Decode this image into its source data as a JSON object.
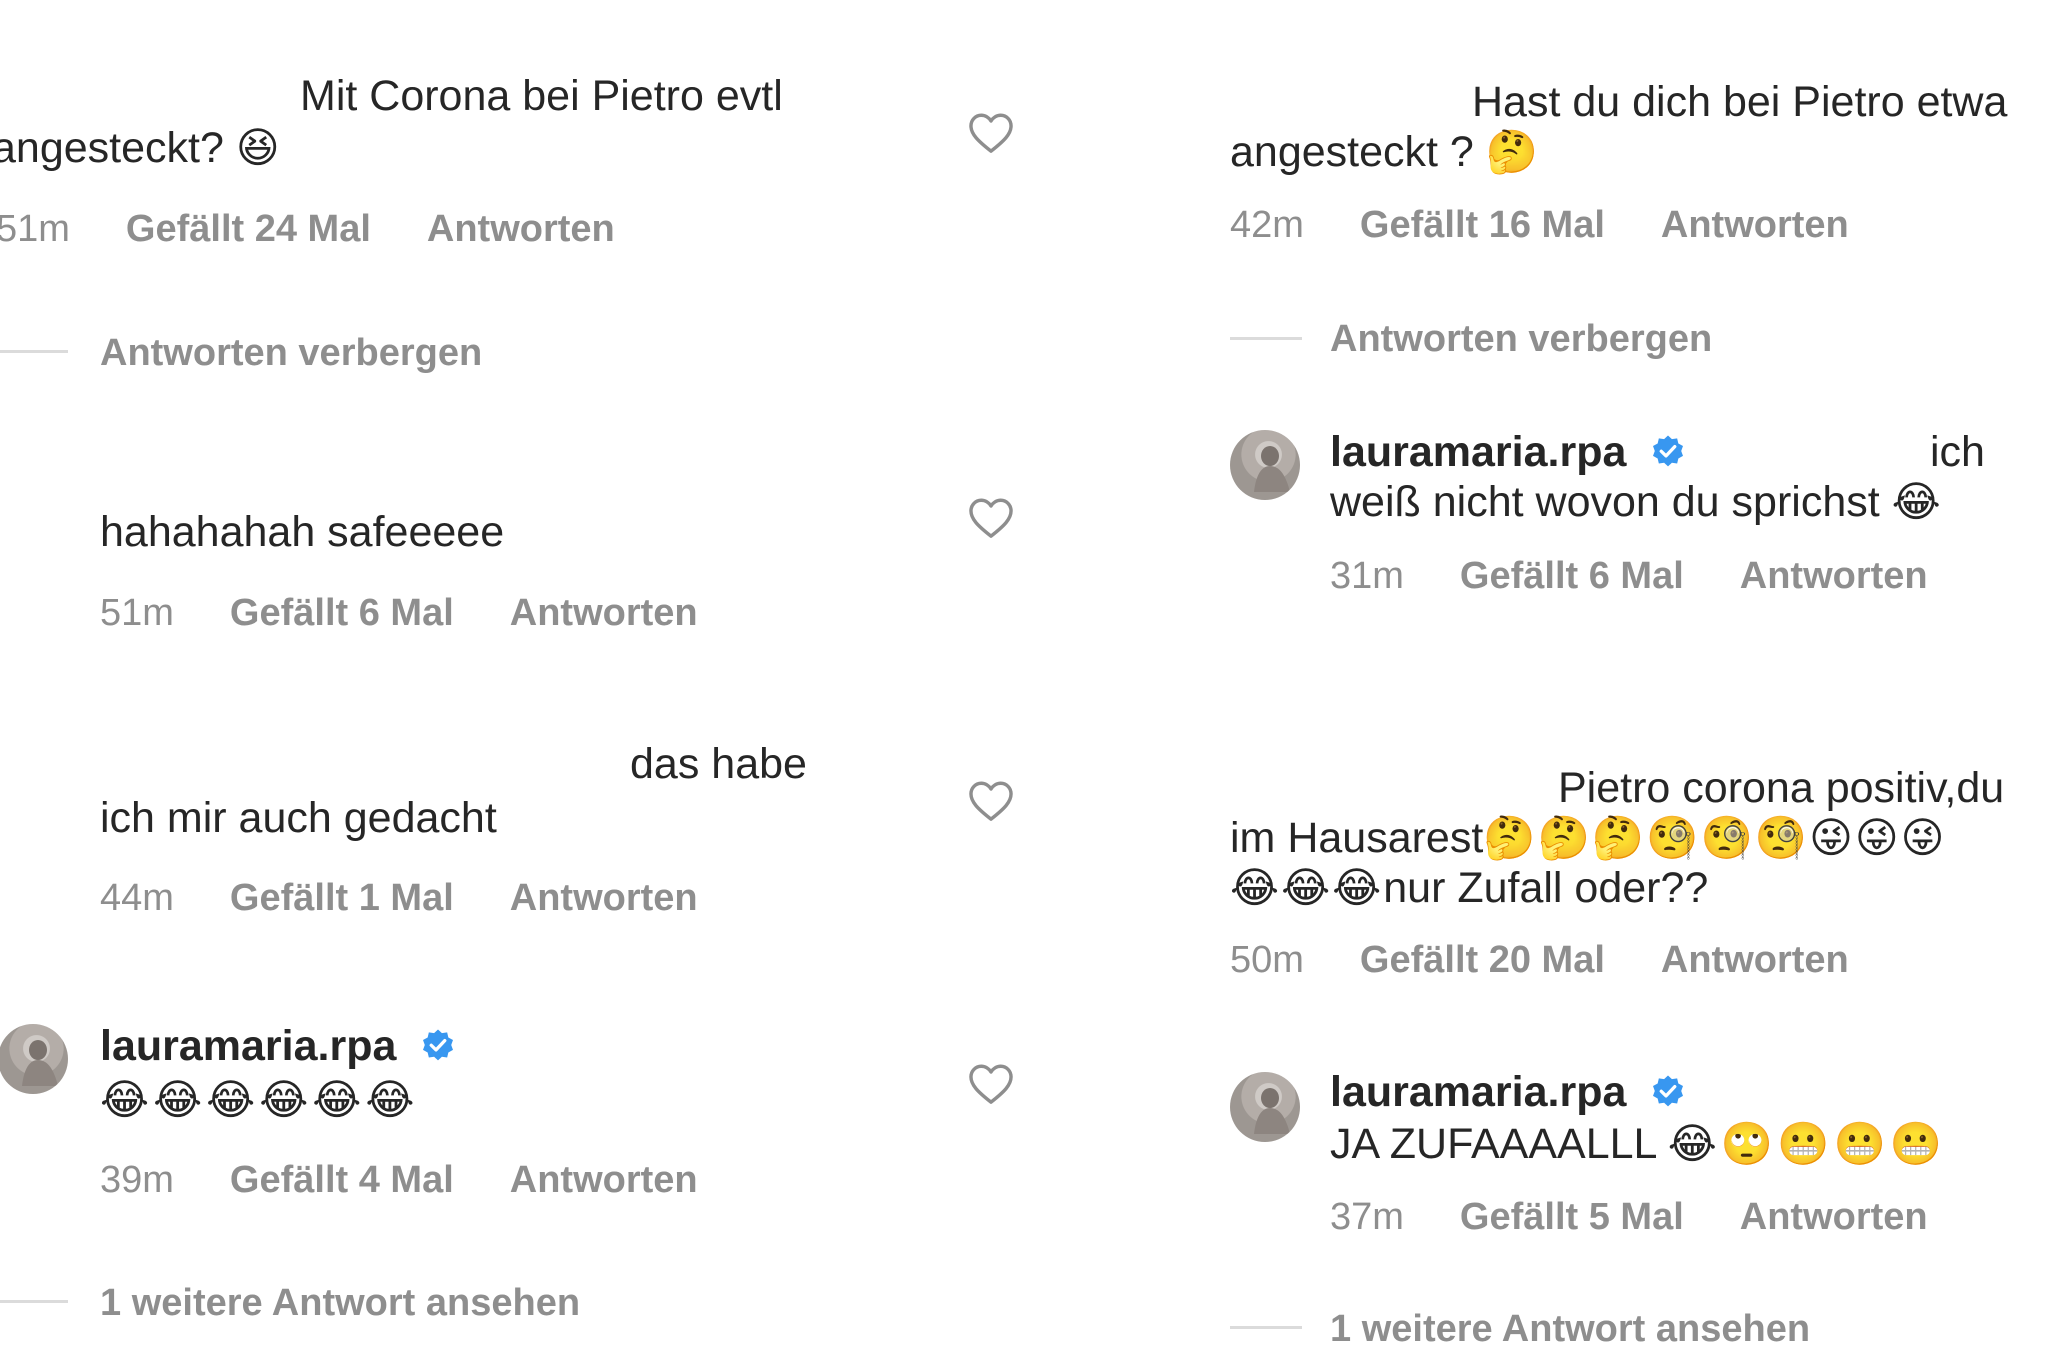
{
  "left": {
    "c1": {
      "line1": "Mit Corona bei Pietro evtl",
      "line2": "angesteckt?",
      "emoji": "😆",
      "time": "51m",
      "likes": "Gefällt 24 Mal",
      "reply": "Antworten"
    },
    "hide": "Antworten verbergen",
    "c2": {
      "text": "hahahahah safeeeee",
      "time": "51m",
      "likes": "Gefällt 6 Mal",
      "reply": "Antworten"
    },
    "c3": {
      "line1": "das habe",
      "line2": "ich mir auch gedacht",
      "time": "44m",
      "likes": "Gefällt 1 Mal",
      "reply": "Antworten"
    },
    "c4": {
      "user": "lauramaria.rpa",
      "emojis": "😂😂😂😂😂😂",
      "time": "39m",
      "likes": "Gefällt 4 Mal",
      "reply": "Antworten"
    },
    "more": "1 weitere Antwort ansehen"
  },
  "right": {
    "c1": {
      "line1": "Hast du dich bei Pietro etwa",
      "line2": "angesteckt ?",
      "emoji": "🤔",
      "time": "42m",
      "likes": "Gefällt 16 Mal",
      "reply": "Antworten"
    },
    "hide": "Antworten verbergen",
    "c2": {
      "user": "lauramaria.rpa",
      "tail": "ich",
      "line2": "weiß nicht wovon du sprichst",
      "emoji": "😂",
      "time": "31m",
      "likes": "Gefällt 6 Mal",
      "reply": "Antworten"
    },
    "c3": {
      "line1": "Pietro corona positiv,du",
      "line2a": "im Hausarest",
      "line2e": "🤔🤔🤔🧐🧐🧐😜😜😜",
      "line3e": "😂😂😂",
      "line3": "nur Zufall oder??",
      "time": "50m",
      "likes": "Gefällt 20 Mal",
      "reply": "Antworten"
    },
    "c4": {
      "user": "lauramaria.rpa",
      "text": "JA ZUFAAAALLL",
      "emojis": "😂🙄😬😬😬",
      "time": "37m",
      "likes": "Gefällt 5 Mal",
      "reply": "Antworten"
    },
    "more": "1 weitere Antwort ansehen"
  },
  "colors": {
    "text": "#262626",
    "meta": "#8e8e8e",
    "verified": "#3897f0",
    "divider": "#dbdbdb"
  },
  "icons": {
    "like": "heart-outline-icon",
    "verified": "verified-badge-icon"
  }
}
